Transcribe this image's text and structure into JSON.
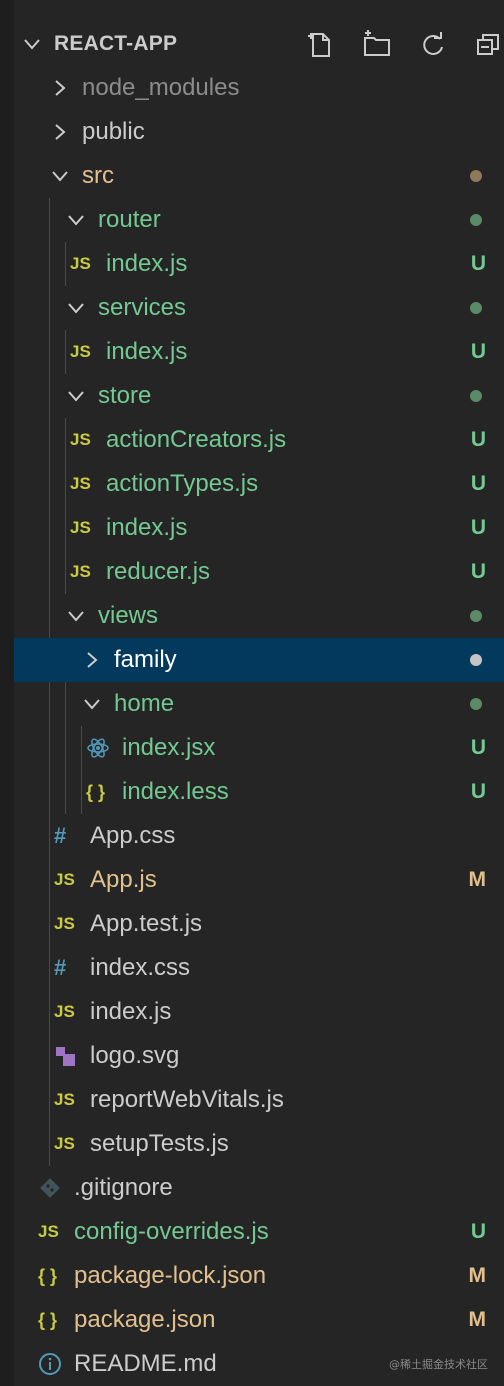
{
  "explorer": {
    "title": "REACT-APP",
    "actions": [
      "new-file",
      "new-folder",
      "refresh",
      "collapse-all"
    ]
  },
  "colors": {
    "green": "#73c991",
    "modified": "#e2c08d",
    "dim": "#8c8c8c",
    "default": "#cccccc",
    "js_icon": "#cbcb41",
    "css_icon": "#519aba",
    "react_icon": "#519aba",
    "svg_icon": "#a074c4",
    "test_icon": "#e37933",
    "selection": "#04395e"
  },
  "tree": [
    {
      "label": "node_modules",
      "kind": "folder",
      "open": false,
      "status": "",
      "icon": ""
    },
    {
      "label": "public",
      "kind": "folder",
      "open": false,
      "status": "",
      "icon": ""
    },
    {
      "label": "src",
      "kind": "folder",
      "open": true,
      "status": "dot-modified",
      "icon": ""
    },
    {
      "label": "router",
      "kind": "folder",
      "open": true,
      "status": "dot-green",
      "icon": ""
    },
    {
      "label": "index.js",
      "kind": "file",
      "status": "U",
      "icon": "JS"
    },
    {
      "label": "services",
      "kind": "folder",
      "open": true,
      "status": "dot-green",
      "icon": ""
    },
    {
      "label": "index.js",
      "kind": "file",
      "status": "U",
      "icon": "JS"
    },
    {
      "label": "store",
      "kind": "folder",
      "open": true,
      "status": "dot-green",
      "icon": ""
    },
    {
      "label": "actionCreators.js",
      "kind": "file",
      "status": "U",
      "icon": "JS"
    },
    {
      "label": "actionTypes.js",
      "kind": "file",
      "status": "U",
      "icon": "JS"
    },
    {
      "label": "index.js",
      "kind": "file",
      "status": "U",
      "icon": "JS"
    },
    {
      "label": "reducer.js",
      "kind": "file",
      "status": "U",
      "icon": "JS"
    },
    {
      "label": "views",
      "kind": "folder",
      "open": true,
      "status": "dot-green",
      "icon": ""
    },
    {
      "label": "family",
      "kind": "folder",
      "open": false,
      "status": "dot-light",
      "icon": ""
    },
    {
      "label": "home",
      "kind": "folder",
      "open": true,
      "status": "dot-green",
      "icon": ""
    },
    {
      "label": "index.jsx",
      "kind": "file",
      "status": "U",
      "icon": "react"
    },
    {
      "label": "index.less",
      "kind": "file",
      "status": "U",
      "icon": "{ }"
    },
    {
      "label": "App.css",
      "kind": "file",
      "status": "",
      "icon": "#"
    },
    {
      "label": "App.js",
      "kind": "file",
      "status": "M",
      "icon": "JS"
    },
    {
      "label": "App.test.js",
      "kind": "file",
      "status": "",
      "icon": "JS"
    },
    {
      "label": "index.css",
      "kind": "file",
      "status": "",
      "icon": "#"
    },
    {
      "label": "index.js",
      "kind": "file",
      "status": "",
      "icon": "JS"
    },
    {
      "label": "logo.svg",
      "kind": "file",
      "status": "",
      "icon": "svg"
    },
    {
      "label": "reportWebVitals.js",
      "kind": "file",
      "status": "",
      "icon": "JS"
    },
    {
      "label": "setupTests.js",
      "kind": "file",
      "status": "",
      "icon": "JS"
    },
    {
      "label": ".gitignore",
      "kind": "file",
      "status": "",
      "icon": "git"
    },
    {
      "label": "config-overrides.js",
      "kind": "file",
      "status": "U",
      "icon": "JS"
    },
    {
      "label": "package-lock.json",
      "kind": "file",
      "status": "M",
      "icon": "{ }"
    },
    {
      "label": "package.json",
      "kind": "file",
      "status": "M",
      "icon": "{ }"
    },
    {
      "label": "README.md",
      "kind": "file",
      "status": "",
      "icon": "info"
    }
  ],
  "watermark": "@稀土掘金技术社区"
}
